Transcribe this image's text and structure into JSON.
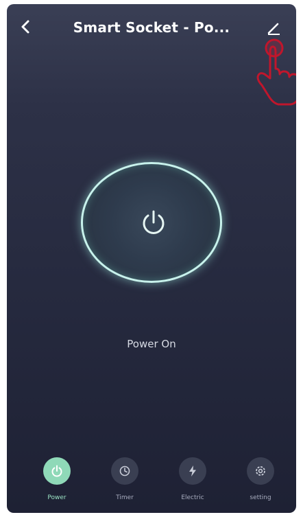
{
  "header": {
    "title": "Smart Socket - Po...",
    "back_icon": "chevron-left-icon",
    "edit_icon": "pencil-icon"
  },
  "power": {
    "state_label": "Power On",
    "icon": "power-icon",
    "ring_color": "#c8f2ec"
  },
  "bottom_nav": {
    "items": [
      {
        "label": "Power",
        "icon": "power-icon",
        "active": true
      },
      {
        "label": "Timer",
        "icon": "clock-icon",
        "active": false
      },
      {
        "label": "Electric",
        "icon": "lightning-icon",
        "active": false
      },
      {
        "label": "setting",
        "icon": "gear-icon",
        "active": false
      }
    ]
  },
  "colors": {
    "background_top": "#3a3f55",
    "background_bottom": "#1e2134",
    "active_tab": "#8fd9b8",
    "annotation_hand": "#c0162c"
  }
}
